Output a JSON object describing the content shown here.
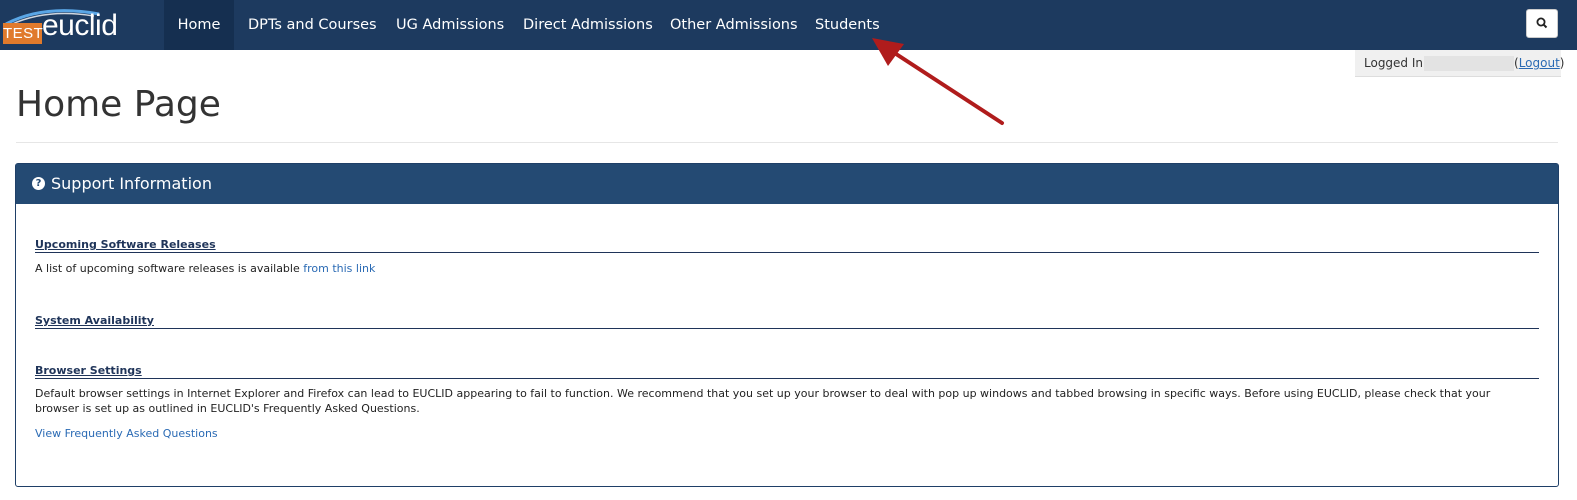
{
  "brand": {
    "badge": "TEST",
    "name": "euclid"
  },
  "nav": {
    "items": [
      {
        "label": "Home",
        "active": true
      },
      {
        "label": "DPTs and Courses",
        "active": false
      },
      {
        "label": "UG Admissions",
        "active": false
      },
      {
        "label": "Direct Admissions",
        "active": false
      },
      {
        "label": "Other Admissions",
        "active": false
      },
      {
        "label": "Students",
        "active": false
      }
    ],
    "search_icon": "search-icon"
  },
  "session": {
    "label": "Logged In:",
    "open_paren": "(",
    "logout": "Logout",
    "close_paren": ")"
  },
  "page": {
    "title": "Home Page"
  },
  "panel": {
    "icon": "help-icon",
    "title": "Support Information",
    "sections": [
      {
        "heading": "Upcoming Software Releases",
        "text": "A list of upcoming software releases is available ",
        "link": "from this link"
      },
      {
        "heading": "System Availability"
      },
      {
        "heading": "Browser Settings",
        "text": "Default browser settings in Internet Explorer and Firefox can lead to EUCLID appearing to fail to function. We recommend that you set up your browser to deal with pop up windows and tabbed browsing in specific ways. Before using EUCLID, please check that your browser is set up as outlined in EUCLID's Frequently Asked Questions.",
        "link": "View Frequently Asked Questions"
      }
    ]
  },
  "colors": {
    "navbar": "#1d3a5f",
    "panel_heading": "#244a73",
    "badge": "#e07a2c",
    "link": "#2a6ab4",
    "arrow": "#b01c1c"
  }
}
